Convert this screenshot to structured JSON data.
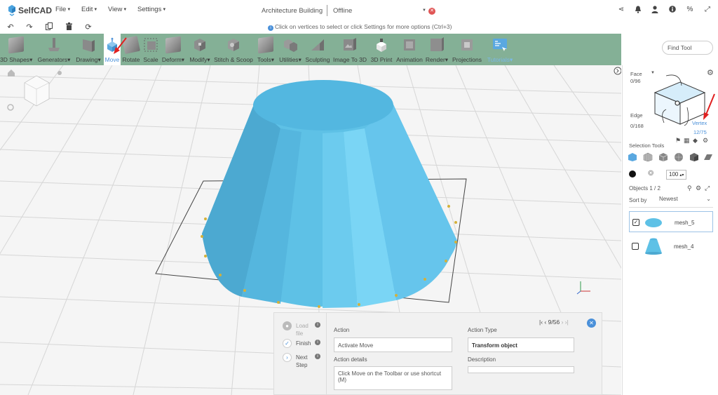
{
  "app": {
    "logo": "SelfCAD",
    "menus": [
      "File",
      "Edit",
      "View",
      "Settings"
    ],
    "document_title": "Architecture Building",
    "document_status": "Offline"
  },
  "hint": {
    "text": "Click on vertices to select or click Settings for more options (Ctrl+3)"
  },
  "toolbar": {
    "tools": [
      {
        "label": "3D Shapes",
        "dropdown": true
      },
      {
        "label": "Generators",
        "dropdown": true
      },
      {
        "label": "Drawing",
        "dropdown": true
      },
      {
        "label": "Move",
        "dropdown": false,
        "active": true
      },
      {
        "label": "Rotate",
        "dropdown": false
      },
      {
        "label": "Scale",
        "dropdown": false
      },
      {
        "label": "Deform",
        "dropdown": true
      },
      {
        "label": "Modify",
        "dropdown": true
      },
      {
        "label": "Stitch & Scoop",
        "dropdown": false
      },
      {
        "label": "Tools",
        "dropdown": true
      },
      {
        "label": "Utilities",
        "dropdown": true
      },
      {
        "label": "Sculpting",
        "dropdown": false
      },
      {
        "label": "Image To 3D",
        "dropdown": false
      },
      {
        "label": "3D Print",
        "dropdown": false
      },
      {
        "label": "Animation",
        "dropdown": false
      },
      {
        "label": "Render",
        "dropdown": true
      },
      {
        "label": "Projections",
        "dropdown": false
      },
      {
        "label": "Tutorials",
        "dropdown": true
      }
    ],
    "find_tool_placeholder": "Find Tool"
  },
  "selection_panel": {
    "face_label": "Face",
    "face_count": "0/96",
    "edge_label": "Edge",
    "edge_count": "0/168",
    "vertex_label": "Vertex",
    "vertex_count": "12/75",
    "selection_tools_label": "Selection Tools",
    "brush_size": "100",
    "objects_label": "Objects 1 / 2",
    "sort_label": "Sort by",
    "sort_value": "Newest",
    "objects": [
      {
        "name": "mesh_5",
        "checked": true,
        "selected": true
      },
      {
        "name": "mesh_4",
        "checked": false,
        "selected": false
      }
    ]
  },
  "tutorial": {
    "steps": [
      {
        "label": "Load file",
        "state": "disabled"
      },
      {
        "label": "Finish",
        "state": "done"
      },
      {
        "label": "Next Step",
        "state": "next"
      }
    ],
    "action_label": "Action",
    "action_value": "Activate Move",
    "action_details_label": "Action details",
    "action_details_value": "Click Move on the Toolbar or use shortcut (M)",
    "action_type_label": "Action Type",
    "action_type_value": "Transform object",
    "description_label": "Description",
    "description_value": "",
    "step_counter": "9/56"
  },
  "colors": {
    "toolbar_bg": "#84b096",
    "object_color": "#5ec1e6",
    "accent": "#4a90d9",
    "annotation_arrow": "#e02020"
  }
}
